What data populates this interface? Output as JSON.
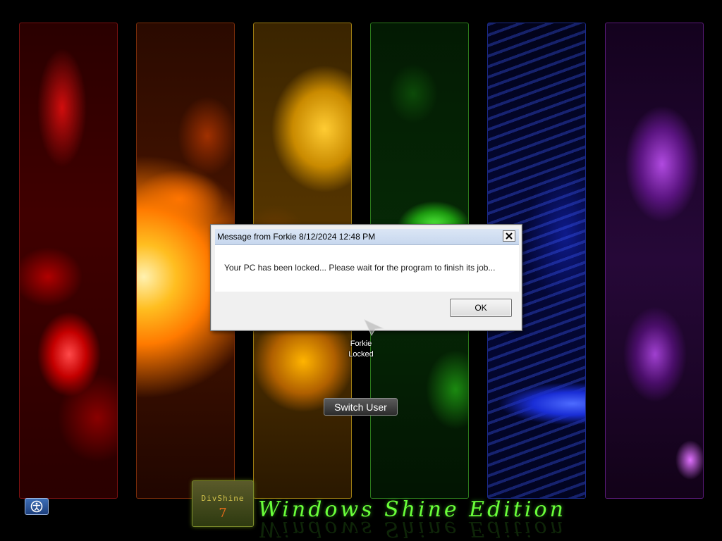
{
  "dialog": {
    "title": "Message from Forkie 8/12/2024 12:48 PM",
    "message": "Your PC has been locked... Please wait for the program to finish its job...",
    "ok_label": "OK",
    "close_icon": "close-icon"
  },
  "user": {
    "name": "Forkie",
    "status": "Locked"
  },
  "switch_user_label": "Switch User",
  "branding": {
    "logo_text": "DivShine",
    "logo_number": "7",
    "edition_title": "Windows Shine Edition"
  },
  "icons": {
    "ease_of_access": "ease-of-access-icon",
    "cursor": "cursor-icon"
  },
  "colors": {
    "edition_green": "#6aff3a",
    "dialog_bg": "#f0f0f0",
    "titlebar": "#c7d7ee"
  }
}
